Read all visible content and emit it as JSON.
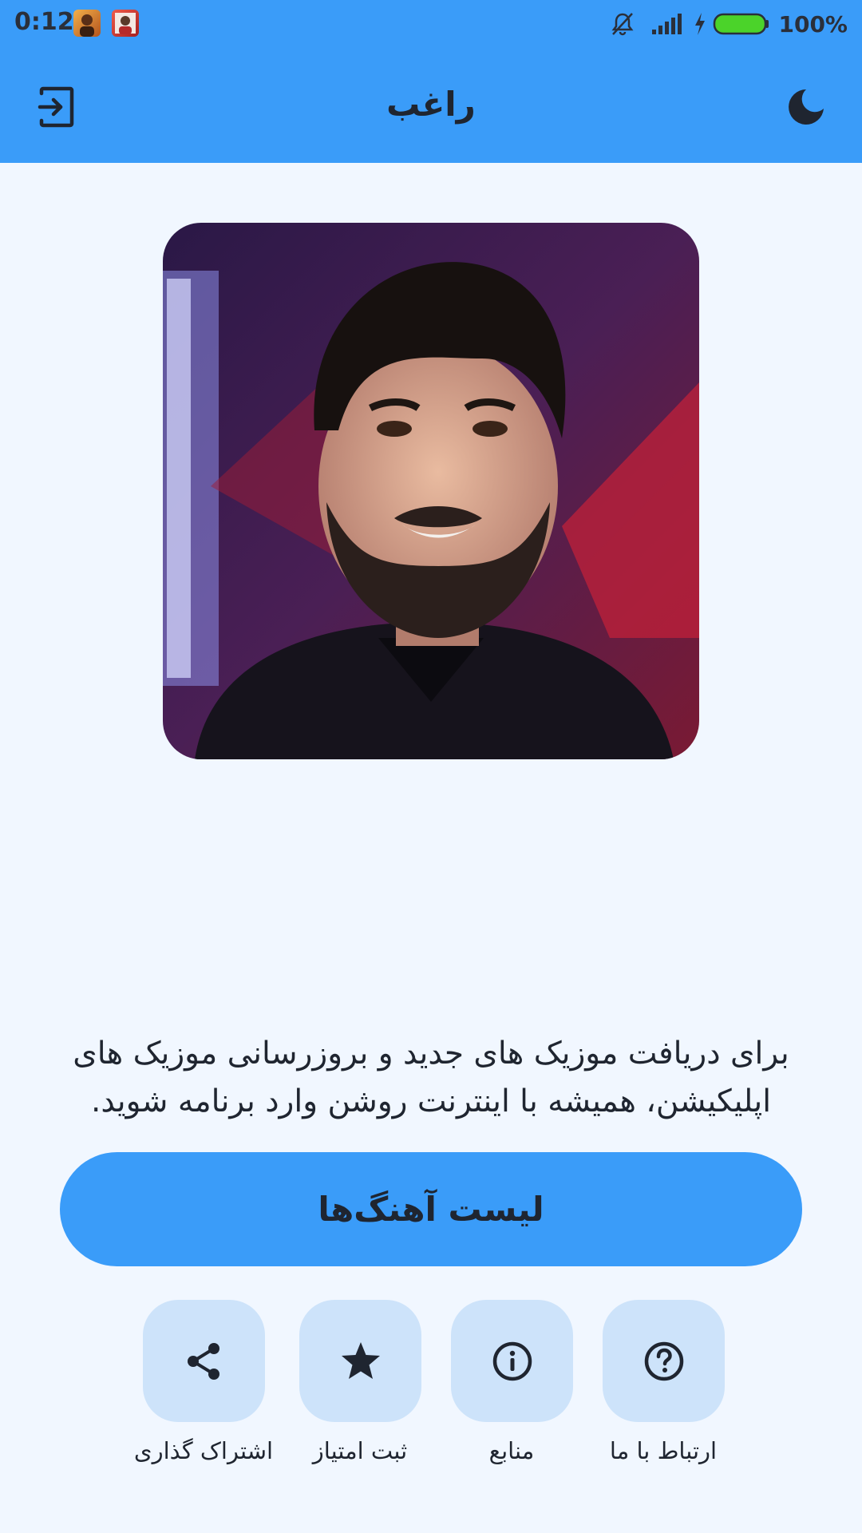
{
  "status_bar": {
    "time": "0:12",
    "battery": "100%"
  },
  "app_bar": {
    "title": "راغب",
    "left_icon": "exit-icon",
    "right_icon": "moon-icon"
  },
  "main": {
    "artist_image": "artist-photo",
    "info_text_line1": "برای دریافت موزیک های جدید و بروزرسانی موزیک های",
    "info_text_line2": "اپلیکیشن، همیشه با اینترنت روشن وارد برنامه شوید.",
    "primary_button": "لیست آهنگ‌ها"
  },
  "actions": [
    {
      "label": "اشتراک گذاری",
      "icon": "share-icon"
    },
    {
      "label": "ثبت امتیاز",
      "icon": "star-icon"
    },
    {
      "label": "منابع",
      "icon": "info-icon"
    },
    {
      "label": "ارتباط با ما",
      "icon": "help-icon"
    }
  ],
  "colors": {
    "accent": "#3A9CF9",
    "background": "#F1F7FF",
    "tile": "#CDE3FA",
    "text": "#1F2530"
  }
}
